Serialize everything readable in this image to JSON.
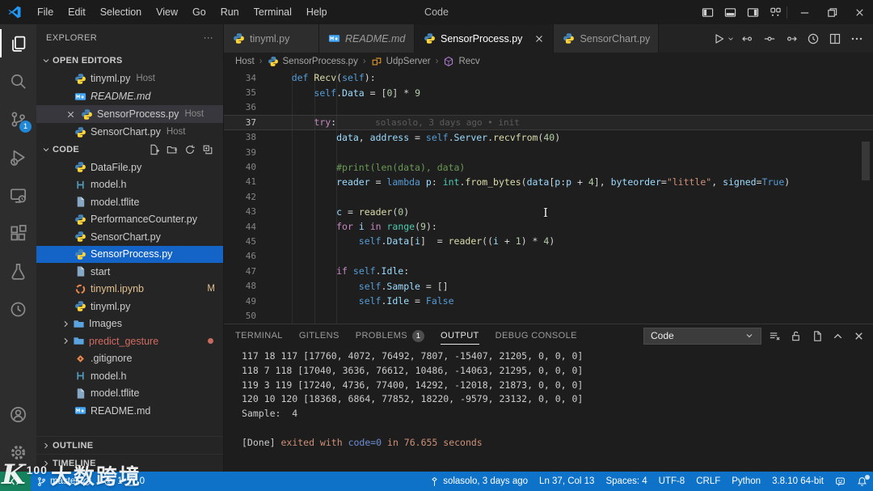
{
  "window": {
    "title": "Code"
  },
  "menubar": {
    "items": [
      "File",
      "Edit",
      "Selection",
      "View",
      "Go",
      "Run",
      "Terminal",
      "Help"
    ]
  },
  "titlebar_icons": [
    "layout-sidebar-left-icon",
    "layout-panel-icon",
    "layout-sidebar-right-icon",
    "customize-layout-icon",
    "minimize-icon",
    "restore-icon",
    "close-icon"
  ],
  "activity_bar": {
    "top": [
      {
        "name": "explorer",
        "icon": "files-icon",
        "active": true
      },
      {
        "name": "search",
        "icon": "search-icon"
      },
      {
        "name": "source-control",
        "icon": "source-control-icon",
        "badge": "1"
      },
      {
        "name": "run-and-debug",
        "icon": "run-debug-icon"
      },
      {
        "name": "remote-explorer",
        "icon": "remote-explorer-icon"
      },
      {
        "name": "extensions",
        "icon": "extensions-icon"
      },
      {
        "name": "testing",
        "icon": "beaker-icon"
      },
      {
        "name": "gitlens",
        "icon": "clock-icon"
      }
    ],
    "bottom": [
      {
        "name": "accounts",
        "icon": "account-icon"
      },
      {
        "name": "settings",
        "icon": "gear-icon"
      }
    ]
  },
  "sidebar": {
    "title": "EXPLORER",
    "open_editors": {
      "label": "OPEN EDITORS",
      "items": [
        {
          "label": "tinyml.py",
          "suffix": "Host",
          "icon": "python-icon"
        },
        {
          "label": "README.md",
          "icon": "markdown-icon",
          "italic": true
        },
        {
          "label": "SensorProcess.py",
          "suffix": "Host",
          "icon": "python-icon",
          "selected": true,
          "close": true
        },
        {
          "label": "SensorChart.py",
          "suffix": "Host",
          "icon": "python-icon"
        }
      ]
    },
    "project": {
      "label": "CODE",
      "actions": [
        "new-file-icon",
        "new-folder-icon",
        "refresh-icon",
        "collapse-all-icon"
      ],
      "items": [
        {
          "label": "DataFile.py",
          "icon": "python-icon"
        },
        {
          "label": "model.h",
          "icon": "h-file-icon"
        },
        {
          "label": "model.tflite",
          "icon": "file-icon"
        },
        {
          "label": "PerformanceCounter.py",
          "icon": "python-icon"
        },
        {
          "label": "SensorChart.py",
          "icon": "python-icon"
        },
        {
          "label": "SensorProcess.py",
          "icon": "python-icon",
          "selected": true
        },
        {
          "label": "start",
          "icon": "file-icon"
        },
        {
          "label": "tinyml.ipynb",
          "icon": "notebook-icon",
          "badge": "M",
          "modified": true
        },
        {
          "label": "tinyml.py",
          "icon": "python-icon"
        },
        {
          "label": "Images",
          "icon": "folder-icon",
          "folder": true
        },
        {
          "label": "predict_gesture",
          "icon": "folder-icon",
          "folder": true,
          "deleted": true,
          "dot": true
        },
        {
          "label": ".gitignore",
          "icon": "gitignore-icon"
        },
        {
          "label": "model.h",
          "icon": "h-file-icon"
        },
        {
          "label": "model.tflite",
          "icon": "file-icon"
        },
        {
          "label": "README.md",
          "icon": "markdown-icon"
        }
      ]
    },
    "outline_label": "OUTLINE",
    "timeline_label": "TIMELINE"
  },
  "editor": {
    "tabs": [
      {
        "label": "tinyml.py",
        "icon": "python-icon"
      },
      {
        "label": "README.md",
        "icon": "markdown-icon",
        "italic": true
      },
      {
        "label": "SensorProcess.py",
        "icon": "python-icon",
        "active": true,
        "close": true
      },
      {
        "label": "SensorChart.py",
        "icon": "python-icon"
      }
    ],
    "actions": [
      "run-python-file-icon",
      "dropdown-chevron-icon",
      "previous-change-icon",
      "open-changes-icon",
      "next-change-icon",
      "gitlens-annotations-icon",
      "split-editor-icon",
      "more-actions-icon"
    ],
    "breadcrumb": [
      {
        "label": "Host"
      },
      {
        "label": "SensorProcess.py",
        "icon": "python-icon"
      },
      {
        "label": "UdpServer",
        "icon": "class-icon"
      },
      {
        "label": "Recv",
        "icon": "method-icon"
      }
    ],
    "code_lines": [
      {
        "n": 34,
        "tokens": [
          [
            "    ",
            "pun"
          ],
          [
            "def",
            "kwdef"
          ],
          [
            " ",
            "pun"
          ],
          [
            "Recv",
            "fn"
          ],
          [
            "(",
            "pun"
          ],
          [
            "self",
            "selfc"
          ],
          [
            "):",
            "pun"
          ]
        ]
      },
      {
        "n": 35,
        "tokens": [
          [
            "        ",
            "pun"
          ],
          [
            "self",
            "selfc"
          ],
          [
            ".",
            "pun"
          ],
          [
            "Data",
            "var"
          ],
          [
            " = [",
            "pun"
          ],
          [
            "0",
            "num"
          ],
          [
            "] * ",
            "pun"
          ],
          [
            "9",
            "num"
          ]
        ]
      },
      {
        "n": 36,
        "tokens": []
      },
      {
        "n": 37,
        "current": true,
        "blame": "solasolo, 3 days ago • init",
        "tokens": [
          [
            "        ",
            "pun"
          ],
          [
            "try",
            "kw"
          ],
          [
            ":",
            "pun"
          ]
        ]
      },
      {
        "n": 38,
        "tokens": [
          [
            "            ",
            "pun"
          ],
          [
            "data",
            "var"
          ],
          [
            ", ",
            "pun"
          ],
          [
            "address",
            "var"
          ],
          [
            " = ",
            "pun"
          ],
          [
            "self",
            "selfc"
          ],
          [
            ".",
            "pun"
          ],
          [
            "Server",
            "var"
          ],
          [
            ".",
            "pun"
          ],
          [
            "recvfrom",
            "fn"
          ],
          [
            "(",
            "pun"
          ],
          [
            "40",
            "num"
          ],
          [
            ")",
            "pun"
          ]
        ]
      },
      {
        "n": 39,
        "tokens": []
      },
      {
        "n": 40,
        "tokens": [
          [
            "            ",
            "pun"
          ],
          [
            "#print(len(data), data)",
            "com"
          ]
        ]
      },
      {
        "n": 41,
        "tokens": [
          [
            "            ",
            "pun"
          ],
          [
            "reader",
            "var"
          ],
          [
            " = ",
            "pun"
          ],
          [
            "lambda",
            "kwdef"
          ],
          [
            " ",
            "pun"
          ],
          [
            "p",
            "var"
          ],
          [
            ": ",
            "pun"
          ],
          [
            "int",
            "cls"
          ],
          [
            ".",
            "pun"
          ],
          [
            "from_bytes",
            "fn"
          ],
          [
            "(",
            "pun"
          ],
          [
            "data",
            "var"
          ],
          [
            "[",
            "pun"
          ],
          [
            "p",
            "var"
          ],
          [
            ":",
            "pun"
          ],
          [
            "p",
            "var"
          ],
          [
            " + ",
            "pun"
          ],
          [
            "4",
            "num"
          ],
          [
            "], ",
            "pun"
          ],
          [
            "byteorder",
            "var"
          ],
          [
            "=",
            "pun"
          ],
          [
            "\"little\"",
            "str"
          ],
          [
            ", ",
            "pun"
          ],
          [
            "signed",
            "var"
          ],
          [
            "=",
            "pun"
          ],
          [
            "True",
            "kwdef"
          ],
          [
            ")",
            "pun"
          ]
        ]
      },
      {
        "n": 42,
        "tokens": []
      },
      {
        "n": 43,
        "tokens": [
          [
            "            ",
            "pun"
          ],
          [
            "c",
            "var"
          ],
          [
            " = ",
            "pun"
          ],
          [
            "reader",
            "fn"
          ],
          [
            "(",
            "pun"
          ],
          [
            "0",
            "num"
          ],
          [
            ")",
            "pun"
          ]
        ]
      },
      {
        "n": 44,
        "tokens": [
          [
            "            ",
            "pun"
          ],
          [
            "for",
            "kw"
          ],
          [
            " ",
            "pun"
          ],
          [
            "i",
            "var"
          ],
          [
            " ",
            "pun"
          ],
          [
            "in",
            "kw"
          ],
          [
            " ",
            "pun"
          ],
          [
            "range",
            "cls"
          ],
          [
            "(",
            "pun"
          ],
          [
            "9",
            "num"
          ],
          [
            "):",
            "pun"
          ]
        ]
      },
      {
        "n": 45,
        "tokens": [
          [
            "                ",
            "pun"
          ],
          [
            "self",
            "selfc"
          ],
          [
            ".",
            "pun"
          ],
          [
            "Data",
            "var"
          ],
          [
            "[",
            "pun"
          ],
          [
            "i",
            "var"
          ],
          [
            "]  = ",
            "pun"
          ],
          [
            "reader",
            "fn"
          ],
          [
            "((",
            "pun"
          ],
          [
            "i",
            "var"
          ],
          [
            " + ",
            "pun"
          ],
          [
            "1",
            "num"
          ],
          [
            ") * ",
            "pun"
          ],
          [
            "4",
            "num"
          ],
          [
            ")",
            "pun"
          ]
        ]
      },
      {
        "n": 46,
        "tokens": []
      },
      {
        "n": 47,
        "tokens": [
          [
            "            ",
            "pun"
          ],
          [
            "if",
            "kw"
          ],
          [
            " ",
            "pun"
          ],
          [
            "self",
            "selfc"
          ],
          [
            ".",
            "pun"
          ],
          [
            "Idle",
            "var"
          ],
          [
            ":",
            "pun"
          ]
        ]
      },
      {
        "n": 48,
        "tokens": [
          [
            "                ",
            "pun"
          ],
          [
            "self",
            "selfc"
          ],
          [
            ".",
            "pun"
          ],
          [
            "Sample",
            "var"
          ],
          [
            " = []",
            "pun"
          ]
        ]
      },
      {
        "n": 49,
        "tokens": [
          [
            "                ",
            "pun"
          ],
          [
            "self",
            "selfc"
          ],
          [
            ".",
            "pun"
          ],
          [
            "Idle",
            "var"
          ],
          [
            " = ",
            "pun"
          ],
          [
            "False",
            "kwdef"
          ]
        ]
      },
      {
        "n": 50,
        "tokens": []
      }
    ]
  },
  "panel": {
    "tabs": [
      {
        "label": "TERMINAL"
      },
      {
        "label": "GITLENS"
      },
      {
        "label": "PROBLEMS",
        "badge": "1"
      },
      {
        "label": "OUTPUT",
        "active": true
      },
      {
        "label": "DEBUG CONSOLE"
      }
    ],
    "channel_select": "Code",
    "actions": [
      "clear-output-icon",
      "unlock-icon",
      "open-log-file-icon",
      "maximize-panel-icon",
      "close-panel-icon"
    ],
    "output_lines": [
      [
        [
          "117 18 117 [17760, 4072, 76492, 7807, -15407, 21205, 0, 0, 0]",
          "plain"
        ]
      ],
      [
        [
          "118 7 118 [17040, 3636, 76612, 10486, -14063, 21295, 0, 0, 0]",
          "plain"
        ]
      ],
      [
        [
          "119 3 119 [17240, 4736, 77400, 14292, -12018, 21873, 0, 0, 0]",
          "plain"
        ]
      ],
      [
        [
          "120 10 120 [18368, 6864, 77852, 18220, -9579, 23132, 0, 0, 0]",
          "plain"
        ]
      ],
      [
        [
          "Sample:  4",
          "plain"
        ]
      ],
      [],
      [
        [
          "[Done] ",
          "plain"
        ],
        [
          "exited with ",
          "orange"
        ],
        [
          "code=0",
          "blue"
        ],
        [
          " in 76.655 seconds",
          "orange"
        ]
      ]
    ]
  },
  "status_bar": {
    "remote": {
      "icon": "remote-icon"
    },
    "left": [
      {
        "name": "git-branch",
        "icon": "branch-icon",
        "label": "master",
        "icon2": "sync-icon"
      },
      {
        "name": "problems-summary",
        "parts": [
          {
            "icon": "error-icon",
            "label": "1"
          },
          {
            "icon": "warning-icon",
            "label": "0"
          }
        ]
      }
    ],
    "right": [
      {
        "name": "gitlens-blame",
        "icon": "milestone-icon",
        "label": "solasolo, 3 days ago"
      },
      {
        "name": "cursor-position",
        "label": "Ln 37, Col 13"
      },
      {
        "name": "indentation",
        "label": "Spaces: 4"
      },
      {
        "name": "encoding",
        "label": "UTF-8"
      },
      {
        "name": "end-of-line",
        "label": "CRLF"
      },
      {
        "name": "language-mode",
        "label": "Python"
      },
      {
        "name": "python-interpreter",
        "label": "3.8.10 64-bit"
      },
      {
        "name": "feedback",
        "icon": "feedback-icon"
      },
      {
        "name": "notifications",
        "icon": "bell-icon",
        "dot": true
      }
    ]
  },
  "watermark": {
    "logo": "K",
    "sup": "100",
    "text": "大数跨境"
  }
}
